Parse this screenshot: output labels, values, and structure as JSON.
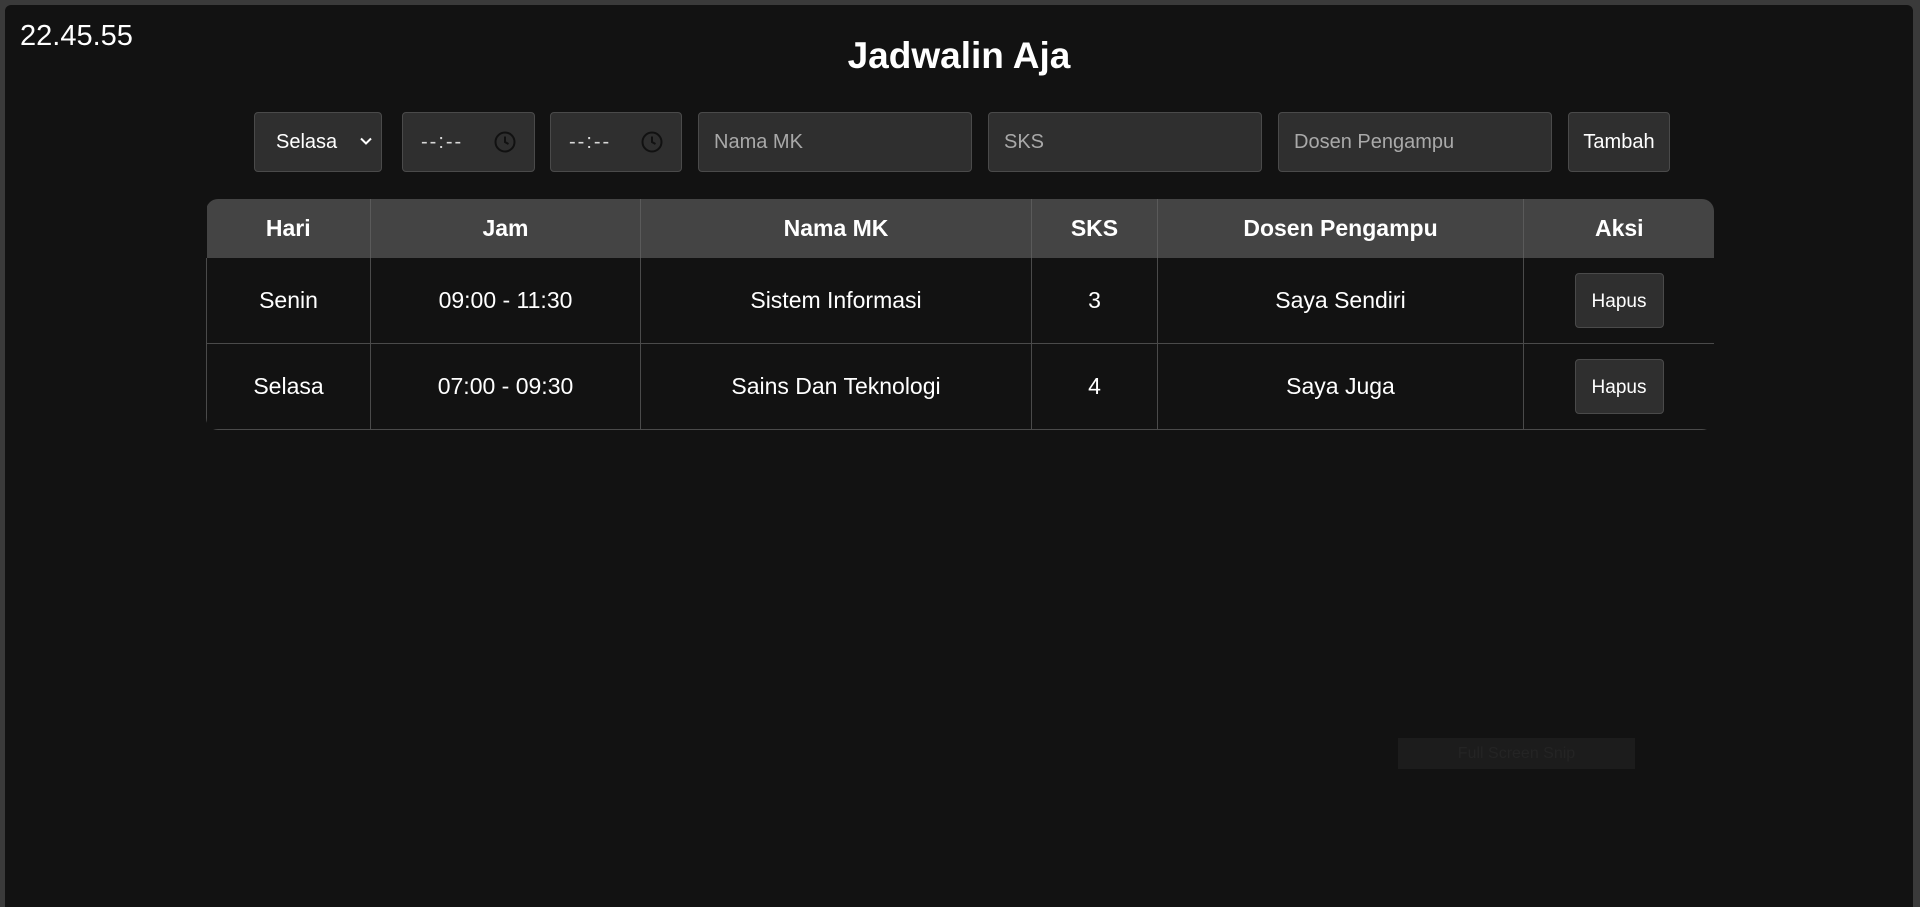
{
  "clock": "22.45.55",
  "title": "Jadwalin Aja",
  "form": {
    "day_value": "Selasa",
    "start_time": "--:--",
    "end_time": "--:--",
    "nama_placeholder": "Nama MK",
    "sks_placeholder": "SKS",
    "dosen_placeholder": "Dosen Pengampu",
    "add_label": "Tambah"
  },
  "table": {
    "headers": [
      "Hari",
      "Jam",
      "Nama MK",
      "SKS",
      "Dosen Pengampu",
      "Aksi"
    ],
    "rows": [
      {
        "hari": "Senin",
        "jam": "09:00 - 11:30",
        "nama": "Sistem Informasi",
        "sks": "3",
        "dosen": "Saya Sendiri",
        "action": "Hapus"
      },
      {
        "hari": "Selasa",
        "jam": "07:00 - 09:30",
        "nama": "Sains Dan Teknologi",
        "sks": "4",
        "dosen": "Saya Juga",
        "action": "Hapus"
      }
    ]
  },
  "footer_ghost": "Full Screen Snip",
  "colors": {
    "background": "#121212",
    "header_bg": "#444444",
    "control_bg": "#2f2f2f"
  }
}
